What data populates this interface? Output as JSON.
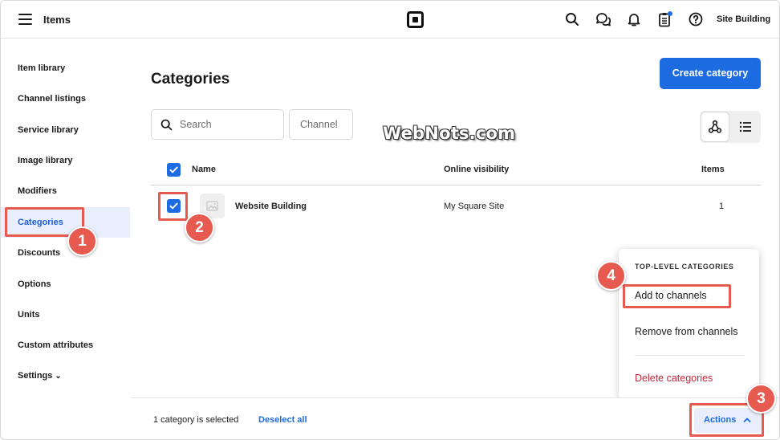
{
  "header": {
    "title": "Items",
    "site_name": "Site Building"
  },
  "sidebar": {
    "items": [
      {
        "label": "Item library"
      },
      {
        "label": "Channel listings"
      },
      {
        "label": "Service library"
      },
      {
        "label": "Image library"
      },
      {
        "label": "Modifiers"
      },
      {
        "label": "Categories",
        "active": true
      },
      {
        "label": "Discounts"
      },
      {
        "label": "Options"
      },
      {
        "label": "Units"
      },
      {
        "label": "Custom attributes"
      },
      {
        "label": "Settings"
      }
    ]
  },
  "main": {
    "title": "Categories",
    "create_button": "Create category",
    "search_placeholder": "Search",
    "channel_filter": "Channel",
    "watermark": "WebNots.com",
    "view_toggle": [
      "tree-view-icon",
      "list-view-icon"
    ]
  },
  "table": {
    "headers": {
      "name": "Name",
      "visibility": "Online visibility",
      "items": "Items"
    },
    "rows": [
      {
        "name": "Website Building",
        "visibility": "My Square Site",
        "items": "1",
        "checked": true
      }
    ]
  },
  "menu": {
    "heading": "TOP-LEVEL CATEGORIES",
    "items": [
      "Add to channels",
      "Remove from channels",
      "Delete categories"
    ]
  },
  "bottom": {
    "selected_text": "1 category is selected",
    "deselect": "Deselect all",
    "actions": "Actions"
  },
  "callouts": [
    "1",
    "2",
    "3",
    "4"
  ],
  "colors": {
    "accent": "#1d6be0",
    "highlight": "#e65a4f",
    "danger": "#c2283a",
    "active_bg": "#e8eefc"
  }
}
